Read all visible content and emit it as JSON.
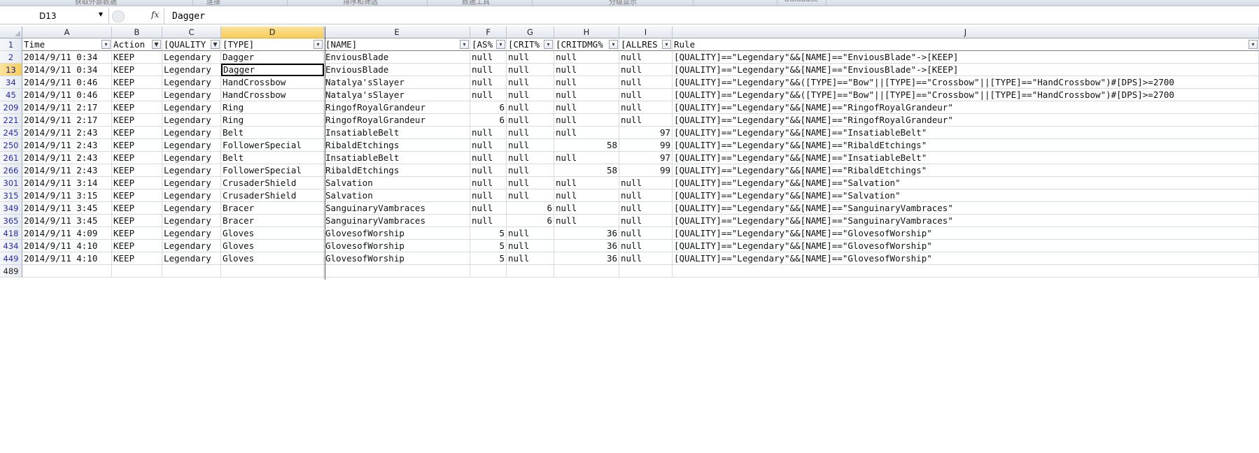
{
  "ribbon": {
    "groups": [
      "获取外部数据",
      "连接",
      "排序和筛选",
      "数据工具",
      "分级显示",
      "DataBase"
    ]
  },
  "formula_bar": {
    "name_box": "D13",
    "fx_label": "fx",
    "formula": "Dagger"
  },
  "columns": [
    {
      "letter": "A",
      "selected": false
    },
    {
      "letter": "B",
      "selected": false
    },
    {
      "letter": "C",
      "selected": false
    },
    {
      "letter": "D",
      "selected": true
    },
    {
      "letter": "E",
      "selected": false
    },
    {
      "letter": "F",
      "selected": false
    },
    {
      "letter": "G",
      "selected": false
    },
    {
      "letter": "H",
      "selected": false
    },
    {
      "letter": "I",
      "selected": false
    },
    {
      "letter": "J",
      "selected": false
    }
  ],
  "header_row": {
    "row_number": "1",
    "cells": [
      "Time",
      "Action",
      "[QUALITY",
      "[TYPE]",
      "[NAME]",
      "[AS%",
      "[CRIT%",
      "[CRITDMG%",
      "[ALLRES",
      "Rule"
    ],
    "filter_icons": [
      "dropdown",
      "filter",
      "filter",
      "dropdown",
      "dropdown",
      "dropdown",
      "dropdown",
      "dropdown",
      "dropdown",
      "dropdown"
    ]
  },
  "rows": [
    {
      "num": "2",
      "cells": [
        "2014/9/11 0:34",
        "KEEP",
        "Legendary",
        "Dagger",
        "EnviousBlade",
        "null",
        "null",
        "null",
        "null",
        "[QUALITY]==\"Legendary\"&&[NAME]==\"EnviousBlade\"->[KEEP]"
      ]
    },
    {
      "num": "13",
      "selected": true,
      "cells": [
        "2014/9/11 0:34",
        "KEEP",
        "Legendary",
        "Dagger",
        "EnviousBlade",
        "null",
        "null",
        "null",
        "null",
        "[QUALITY]==\"Legendary\"&&[NAME]==\"EnviousBlade\"->[KEEP]"
      ]
    },
    {
      "num": "34",
      "cells": [
        "2014/9/11 0:46",
        "KEEP",
        "Legendary",
        "HandCrossbow",
        "Natalya'sSlayer",
        "null",
        "null",
        "null",
        "null",
        "[QUALITY]==\"Legendary\"&&([TYPE]==\"Bow\"||[TYPE]==\"Crossbow\"||[TYPE]==\"HandCrossbow\")#[DPS]>=2700"
      ]
    },
    {
      "num": "45",
      "cells": [
        "2014/9/11 0:46",
        "KEEP",
        "Legendary",
        "HandCrossbow",
        "Natalya'sSlayer",
        "null",
        "null",
        "null",
        "null",
        "[QUALITY]==\"Legendary\"&&([TYPE]==\"Bow\"||[TYPE]==\"Crossbow\"||[TYPE]==\"HandCrossbow\")#[DPS]>=2700"
      ]
    },
    {
      "num": "209",
      "cells": [
        "2014/9/11 2:17",
        "KEEP",
        "Legendary",
        "Ring",
        "RingofRoyalGrandeur",
        "6",
        "null",
        "null",
        "null",
        "[QUALITY]==\"Legendary\"&&[NAME]==\"RingofRoyalGrandeur\""
      ]
    },
    {
      "num": "221",
      "cells": [
        "2014/9/11 2:17",
        "KEEP",
        "Legendary",
        "Ring",
        "RingofRoyalGrandeur",
        "6",
        "null",
        "null",
        "null",
        "[QUALITY]==\"Legendary\"&&[NAME]==\"RingofRoyalGrandeur\""
      ]
    },
    {
      "num": "245",
      "cells": [
        "2014/9/11 2:43",
        "KEEP",
        "Legendary",
        "Belt",
        "InsatiableBelt",
        "null",
        "null",
        "null",
        "97",
        "[QUALITY]==\"Legendary\"&&[NAME]==\"InsatiableBelt\""
      ]
    },
    {
      "num": "250",
      "cells": [
        "2014/9/11 2:43",
        "KEEP",
        "Legendary",
        "FollowerSpecial",
        "RibaldEtchings",
        "null",
        "null",
        "58",
        "99",
        "[QUALITY]==\"Legendary\"&&[NAME]==\"RibaldEtchings\""
      ]
    },
    {
      "num": "261",
      "cells": [
        "2014/9/11 2:43",
        "KEEP",
        "Legendary",
        "Belt",
        "InsatiableBelt",
        "null",
        "null",
        "null",
        "97",
        "[QUALITY]==\"Legendary\"&&[NAME]==\"InsatiableBelt\""
      ]
    },
    {
      "num": "266",
      "cells": [
        "2014/9/11 2:43",
        "KEEP",
        "Legendary",
        "FollowerSpecial",
        "RibaldEtchings",
        "null",
        "null",
        "58",
        "99",
        "[QUALITY]==\"Legendary\"&&[NAME]==\"RibaldEtchings\""
      ]
    },
    {
      "num": "301",
      "cells": [
        "2014/9/11 3:14",
        "KEEP",
        "Legendary",
        "CrusaderShield",
        "Salvation",
        "null",
        "null",
        "null",
        "null",
        "[QUALITY]==\"Legendary\"&&[NAME]==\"Salvation\""
      ]
    },
    {
      "num": "315",
      "cells": [
        "2014/9/11 3:15",
        "KEEP",
        "Legendary",
        "CrusaderShield",
        "Salvation",
        "null",
        "null",
        "null",
        "null",
        "[QUALITY]==\"Legendary\"&&[NAME]==\"Salvation\""
      ]
    },
    {
      "num": "349",
      "cells": [
        "2014/9/11 3:45",
        "KEEP",
        "Legendary",
        "Bracer",
        "SanguinaryVambraces",
        "null",
        "6",
        "null",
        "null",
        "[QUALITY]==\"Legendary\"&&[NAME]==\"SanguinaryVambraces\""
      ]
    },
    {
      "num": "365",
      "cells": [
        "2014/9/11 3:45",
        "KEEP",
        "Legendary",
        "Bracer",
        "SanguinaryVambraces",
        "null",
        "6",
        "null",
        "null",
        "[QUALITY]==\"Legendary\"&&[NAME]==\"SanguinaryVambraces\""
      ]
    },
    {
      "num": "418",
      "cells": [
        "2014/9/11 4:09",
        "KEEP",
        "Legendary",
        "Gloves",
        "GlovesofWorship",
        "5",
        "null",
        "36",
        "null",
        "[QUALITY]==\"Legendary\"&&[NAME]==\"GlovesofWorship\""
      ]
    },
    {
      "num": "434",
      "cells": [
        "2014/9/11 4:10",
        "KEEP",
        "Legendary",
        "Gloves",
        "GlovesofWorship",
        "5",
        "null",
        "36",
        "null",
        "[QUALITY]==\"Legendary\"&&[NAME]==\"GlovesofWorship\""
      ]
    },
    {
      "num": "449",
      "cells": [
        "2014/9/11 4:10",
        "KEEP",
        "Legendary",
        "Gloves",
        "GlovesofWorship",
        "5",
        "null",
        "36",
        "null",
        "[QUALITY]==\"Legendary\"&&[NAME]==\"GlovesofWorship\""
      ]
    },
    {
      "num": "489",
      "plain": true,
      "cells": [
        "",
        "",
        "",
        "",
        "",
        "",
        "",
        "",
        "",
        ""
      ]
    }
  ]
}
